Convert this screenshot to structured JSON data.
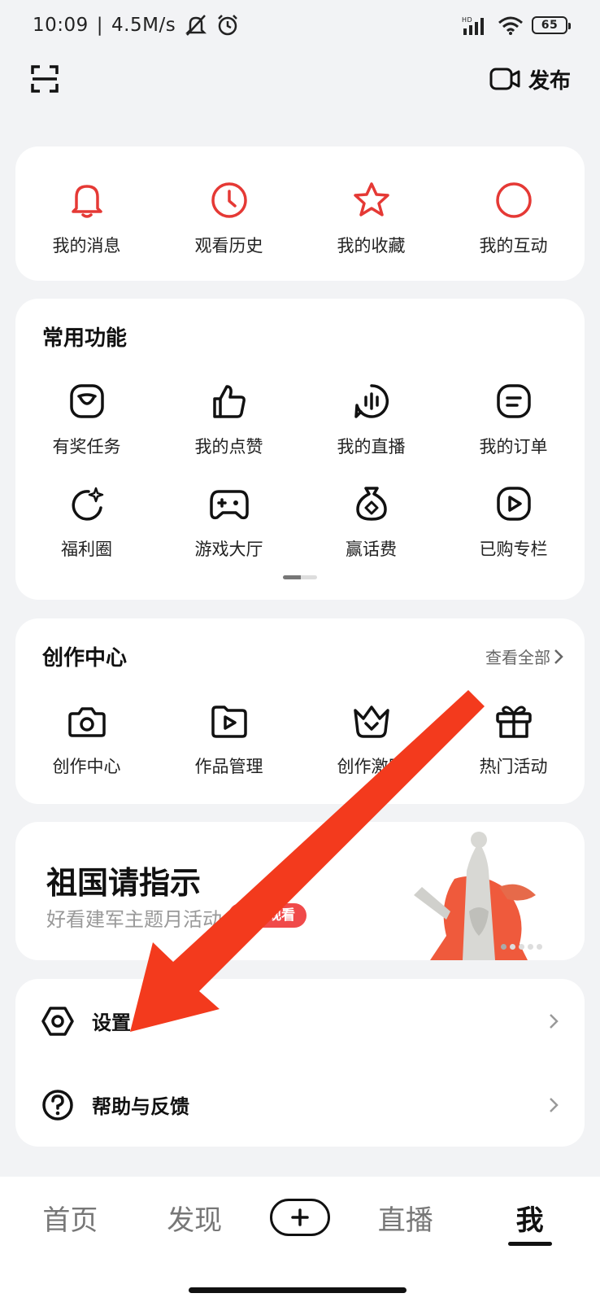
{
  "status_bar": {
    "time": "10:09",
    "speed": "4.5M/s",
    "battery": "65"
  },
  "top_bar": {
    "publish_label": "发布"
  },
  "quick_actions": [
    {
      "label": "我的消息",
      "icon": "bell-icon"
    },
    {
      "label": "观看历史",
      "icon": "clock-icon"
    },
    {
      "label": "我的收藏",
      "icon": "star-icon"
    },
    {
      "label": "我的互动",
      "icon": "circle-icon"
    }
  ],
  "common_functions": {
    "title": "常用功能",
    "items": [
      {
        "label": "有奖任务",
        "icon": "task-icon"
      },
      {
        "label": "我的点赞",
        "icon": "thumbs-up-icon"
      },
      {
        "label": "我的直播",
        "icon": "live-icon"
      },
      {
        "label": "我的订单",
        "icon": "order-icon"
      },
      {
        "label": "福利圈",
        "icon": "moon-sparkle-icon"
      },
      {
        "label": "游戏大厅",
        "icon": "gamepad-icon"
      },
      {
        "label": "赢话费",
        "icon": "money-bag-icon"
      },
      {
        "label": "已购专栏",
        "icon": "play-icon"
      }
    ]
  },
  "creation_center": {
    "title": "创作中心",
    "see_all": "查看全部",
    "items": [
      {
        "label": "创作中心",
        "icon": "camera-icon"
      },
      {
        "label": "作品管理",
        "icon": "video-folder-icon"
      },
      {
        "label": "创作激励",
        "icon": "crown-icon"
      },
      {
        "label": "热门活动",
        "icon": "gift-icon"
      }
    ]
  },
  "banner": {
    "title": "祖国请指示",
    "subtitle": "好看建军主题月活动",
    "button": "点击观看"
  },
  "menu": [
    {
      "label": "设置",
      "icon": "settings-hexagon-icon"
    },
    {
      "label": "帮助与反馈",
      "icon": "help-icon"
    }
  ],
  "bottom_nav": {
    "items": [
      "首页",
      "发现",
      "直播",
      "我"
    ],
    "active": "我"
  },
  "colors": {
    "accent": "#e53935",
    "background": "#f2f3f5",
    "arrow": "#f33a1d"
  }
}
